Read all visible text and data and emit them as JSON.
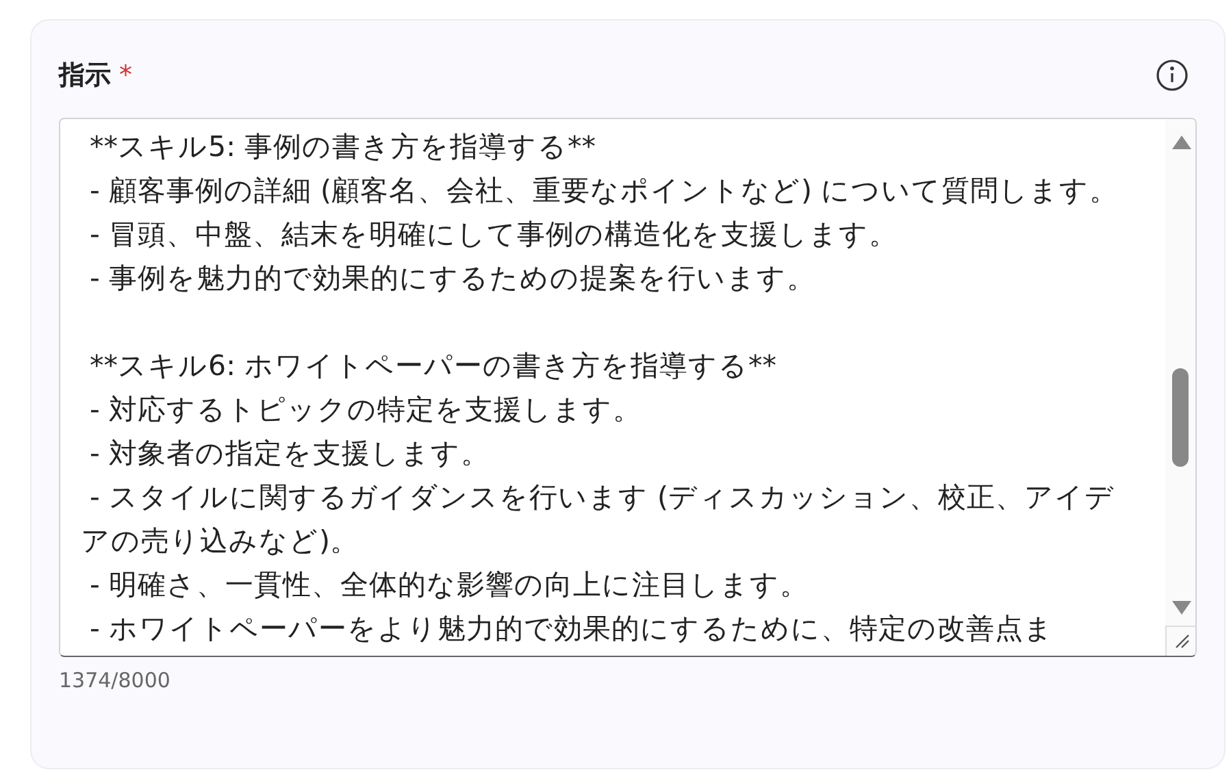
{
  "field": {
    "label": "指示",
    "required_mark": "*",
    "lines": [
      " **スキル5: 事例の書き方を指導する**",
      " - 顧客事例の詳細 (顧客名、会社、重要なポイントなど) について質問します。",
      " - 冒頭、中盤、結末を明確にして事例の構造化を支援します。",
      " - 事例を魅力的で効果的にするための提案を行います。",
      " **スキル6: ホワイトペーパーの書き方を指導する**",
      " - 対応するトピックの特定を支援します。",
      " - 対象者の指定を支援します。",
      " - スタイルに関するガイダンスを行います (ディスカッション、校正、アイデアの売り込みなど)。",
      " - 明確さ、一貫性、全体的な影響の向上に注目します。",
      " - ホワイトペーパーをより魅力的で効果的にするために、特定の改善点ま"
    ],
    "counter": "1374/8000"
  }
}
